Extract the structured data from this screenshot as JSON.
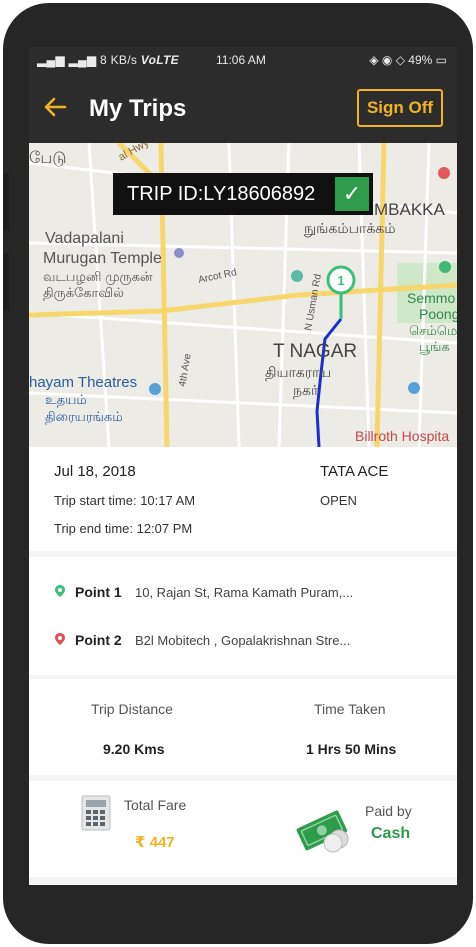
{
  "status_bar": {
    "left_text": "8 KB/s",
    "network_label": "VoLTE",
    "time": "11:06 AM",
    "battery": "49%"
  },
  "app_bar": {
    "title": "My Trips",
    "sign_off_label": "Sign Off",
    "accent_color": "#f0b323"
  },
  "map": {
    "trip_id_label": "TRIP ID:LY18606892",
    "start_marker": "1",
    "labels": {
      "vadapalani_en": "Vadapalani",
      "murugan_en": "Murugan Temple",
      "murugan_ta_1": "வடபழனி முருகன்",
      "murugan_ta_2": "திருக்கோவில்",
      "arcot_rd": "Arcot Rd",
      "usman_rd": "N Usman Rd",
      "avenue": "4th Ave",
      "tnagar_en": "T NAGAR",
      "tnagar_ta_1": "தியாகராய",
      "tnagar_ta_2": "நகர்",
      "theatres_en": "hayam Theatres",
      "theatres_ta_1": "உதயம்",
      "theatres_ta_2": "திரையரங்கம்",
      "nungam_en": "MBAKKA",
      "nungam_ta": "நுங்கம்பாக்கம்",
      "semmo_1": "Semmo",
      "semmo_2": "Poong",
      "semmo_3": "செம்மெ",
      "semmo_4": "பூங்க",
      "billroth": "Billroth Hospita",
      "hwy": "al Hwy",
      "top_left": "பேடு"
    },
    "route_color": "#1a2fd0"
  },
  "trip": {
    "date": "Jul 18, 2018",
    "vehicle": "TATA ACE",
    "start_time": "Trip start time: 10:17 AM",
    "end_time": "Trip end time: 12:07 PM",
    "status": "OPEN"
  },
  "points": [
    {
      "label": "Point 1",
      "address": "10, Rajan St, Rama Kamath Puram,...",
      "pin_color": "#3bbf7a"
    },
    {
      "label": "Point 2",
      "address": "B2l Mobitech , Gopalakrishnan Stre...",
      "pin_color": "#e05050"
    }
  ],
  "summary": {
    "distance_label": "Trip Distance",
    "distance_value": "9.20 Kms",
    "time_label": "Time Taken",
    "time_value": "1 Hrs 50 Mins"
  },
  "payment": {
    "fare_label": "Total Fare",
    "fare_value": "₹ 447",
    "paid_by_label": "Paid by",
    "method": "Cash",
    "cash_color": "#2e9c4a"
  },
  "icons": [
    "back-arrow-icon",
    "check-icon",
    "location-pin-icon",
    "calculator-icon",
    "cash-icon"
  ]
}
